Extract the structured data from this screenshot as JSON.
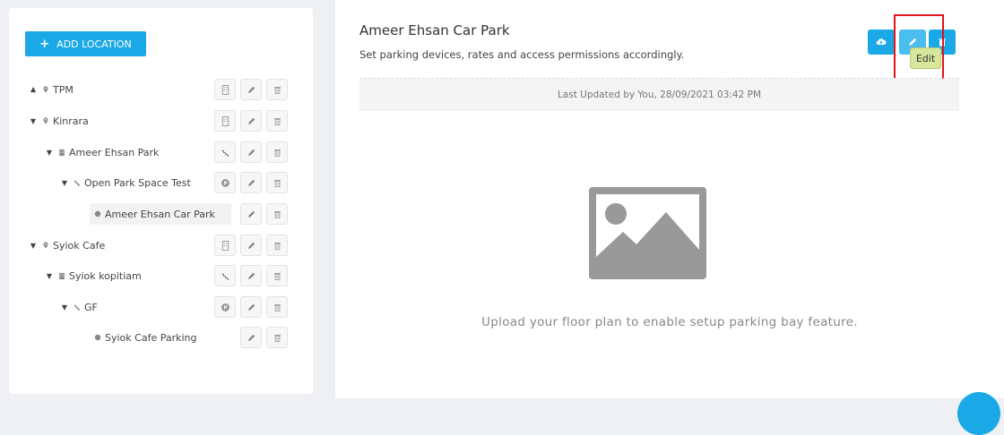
{
  "left": {
    "add_location": "ADD LOCATION",
    "tree": [
      {
        "label": "TPM",
        "caret": "up",
        "icon": "pin",
        "actions": [
          "building-icon",
          "edit-icon",
          "trash-icon"
        ]
      },
      {
        "label": "Kinrara",
        "caret": "down",
        "icon": "pin",
        "actions": [
          "building-icon",
          "edit-icon",
          "trash-icon"
        ]
      },
      {
        "label": "Ameer Ehsan Park",
        "caret": "down",
        "icon": "building",
        "actions": [
          "stairs-icon",
          "edit-icon",
          "trash-icon"
        ]
      },
      {
        "label": "Open Park Space Test",
        "caret": "down",
        "icon": "stairs",
        "actions": [
          "parking-icon",
          "edit-icon",
          "trash-icon"
        ]
      },
      {
        "label": "Ameer Ehsan Car Park",
        "caret": "",
        "icon": "dot",
        "actions": [
          "edit-icon",
          "trash-icon"
        ]
      },
      {
        "label": "Syiok Cafe",
        "caret": "down",
        "icon": "pin",
        "actions": [
          "building-icon",
          "edit-icon",
          "trash-icon"
        ]
      },
      {
        "label": "Syiok kopitiam",
        "caret": "down",
        "icon": "building",
        "actions": [
          "stairs-icon",
          "edit-icon",
          "trash-icon"
        ]
      },
      {
        "label": "GF",
        "caret": "down",
        "icon": "stairs",
        "actions": [
          "parking-icon",
          "edit-icon",
          "trash-icon"
        ]
      },
      {
        "label": "Syiok Cafe Parking",
        "caret": "",
        "icon": "dot",
        "actions": [
          "edit-icon",
          "trash-icon"
        ]
      }
    ]
  },
  "detail": {
    "title": "Ameer Ehsan Car Park",
    "subtitle": "Set parking devices, rates and access permissions accordingly.",
    "tooltip": "Edit",
    "last_updated": "Last Updated by You, 28/09/2021 03:42 PM",
    "upload_message": "Upload your floor plan to enable setup parking bay feature."
  },
  "colors": {
    "accent": "#1aa9e6",
    "highlight": "#e0141a",
    "tooltip_bg": "#d6e79c"
  }
}
